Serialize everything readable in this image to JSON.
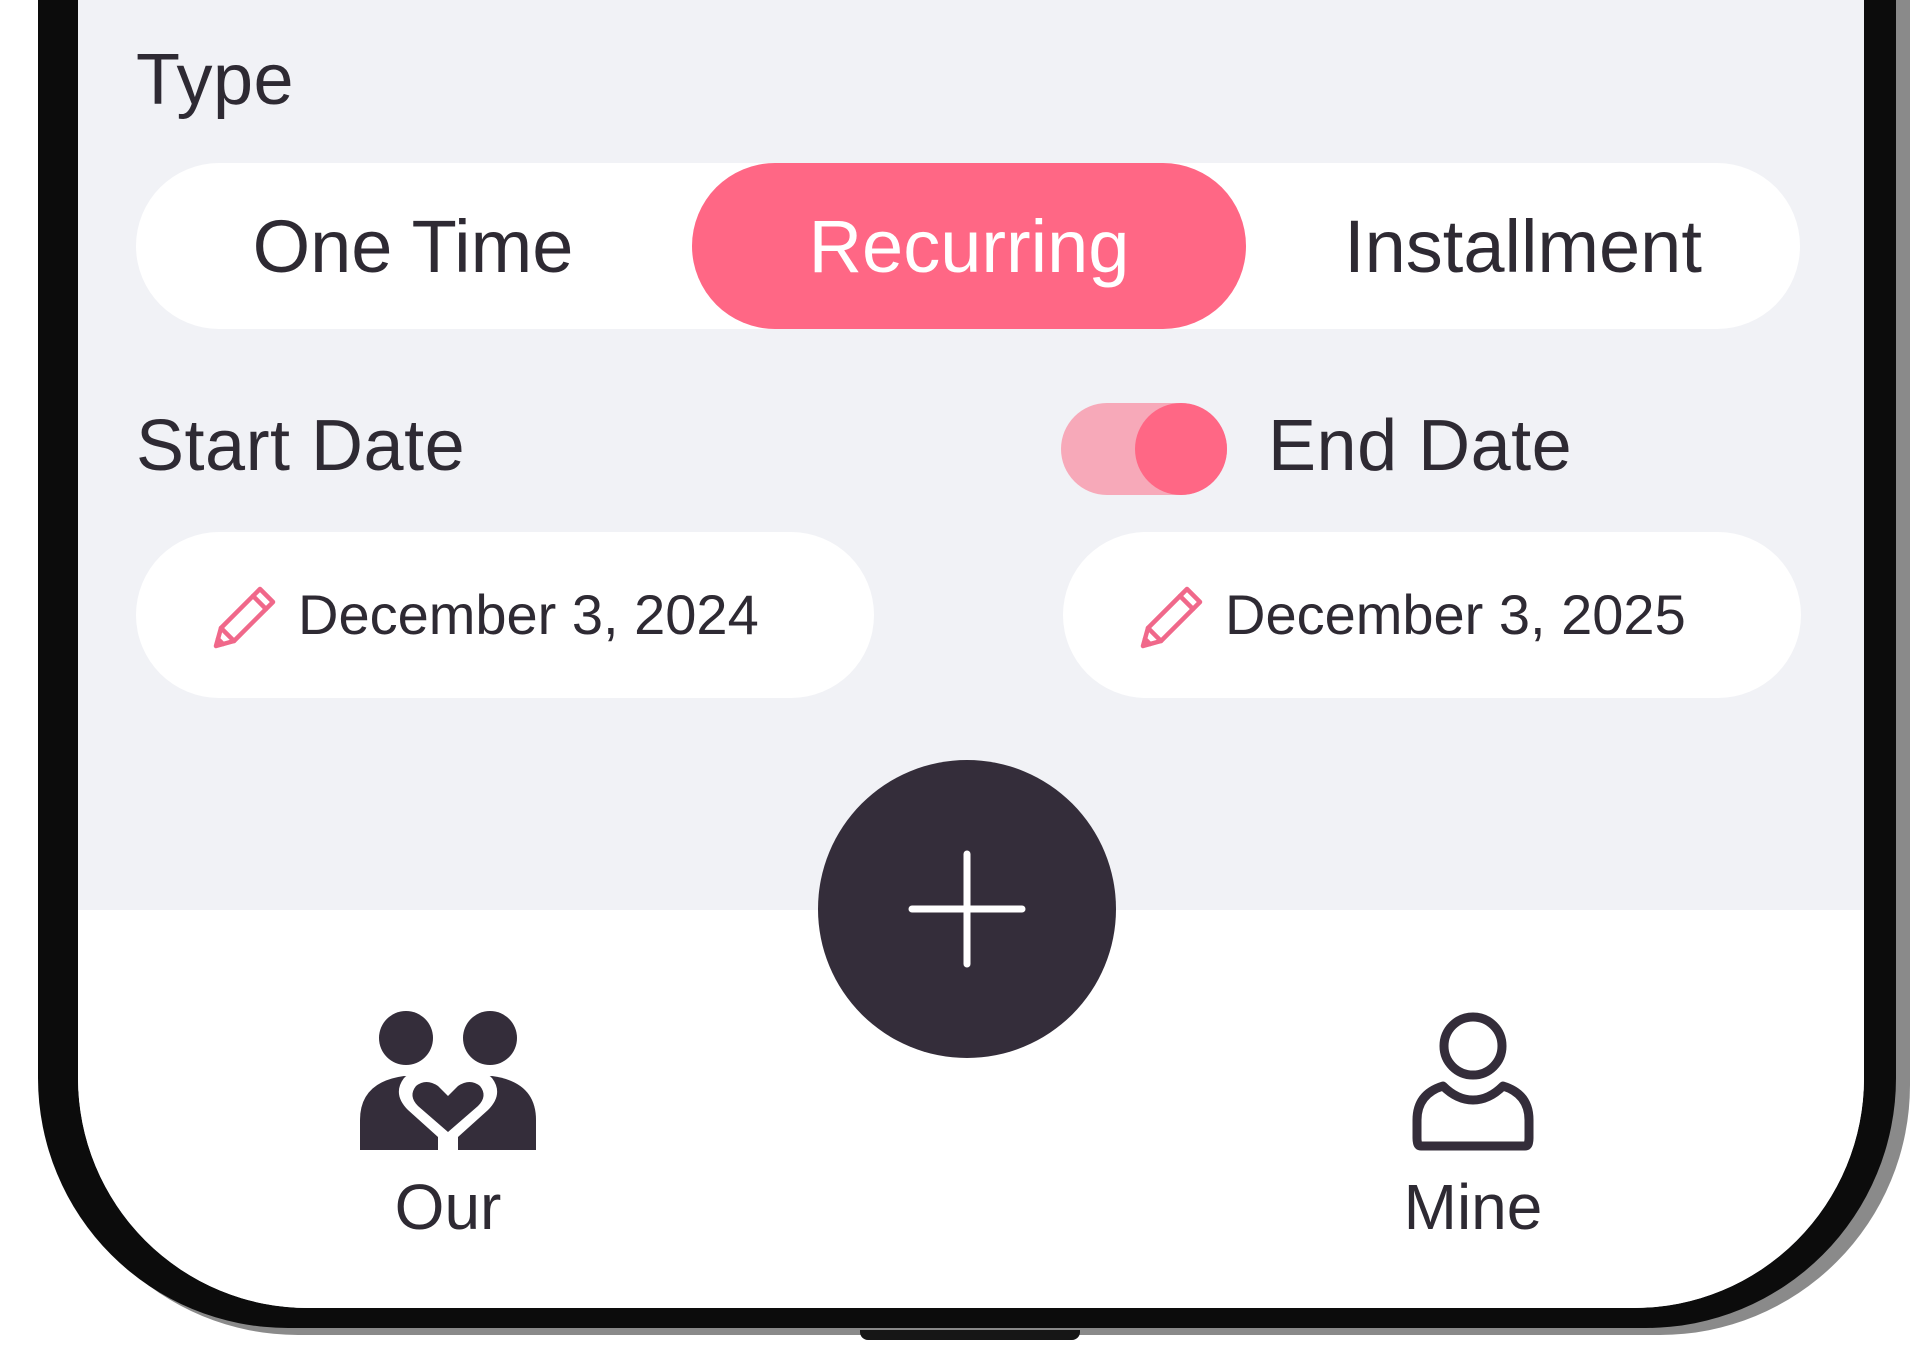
{
  "form": {
    "type_label": "Type",
    "type_options": [
      {
        "label": "One Time",
        "selected": false
      },
      {
        "label": "Recurring",
        "selected": true
      },
      {
        "label": "Installment",
        "selected": false
      }
    ],
    "start_date_label": "Start Date",
    "end_date_label": "End Date",
    "end_date_toggle_on": true,
    "start_date_value": "December 3, 2024",
    "end_date_value": "December 3, 2025",
    "field_icon": "pencil-icon"
  },
  "fab": {
    "icon": "plus-icon"
  },
  "nav": {
    "items": [
      {
        "label": "Our",
        "icon": "couple-heart-icon"
      },
      {
        "label": "Mine",
        "icon": "person-outline-icon"
      }
    ]
  },
  "colors": {
    "accent": "#ff6785",
    "accent_light": "#f7a9b9",
    "dark": "#342d3a",
    "text": "#2e2a33",
    "background": "#f1f2f6",
    "surface": "#ffffff"
  }
}
